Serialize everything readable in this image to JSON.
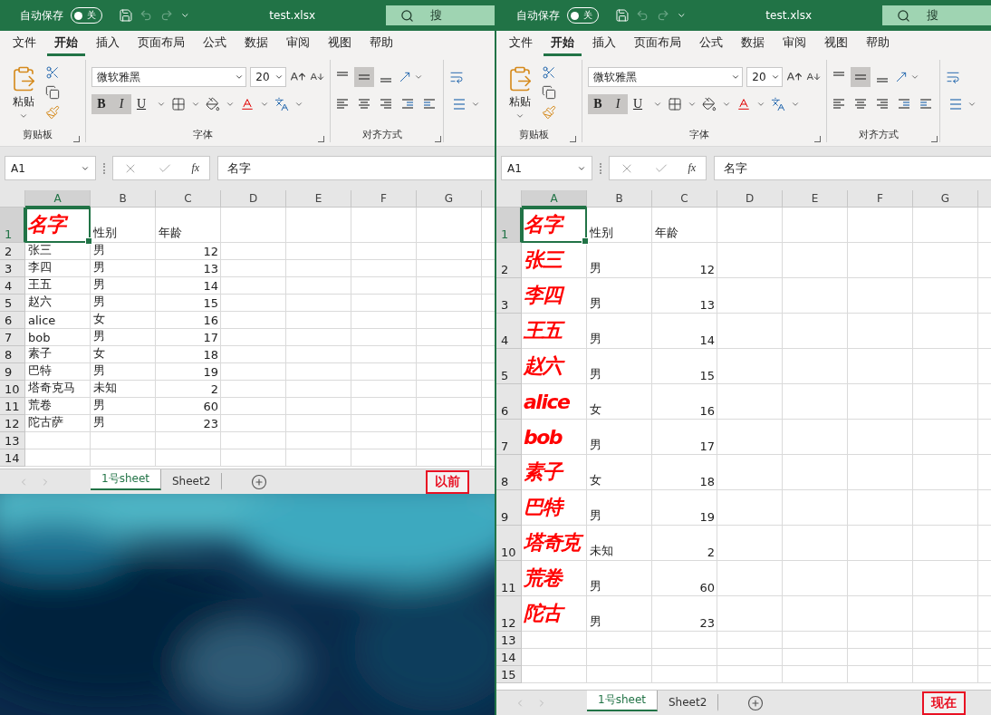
{
  "windows": [
    {
      "title_bar": {
        "autosave_label": "自动保存",
        "autosave": {
          "on": false,
          "text": "关"
        },
        "file_name": "test.xlsx",
        "search": "搜"
      },
      "ribbon_tabs": [
        {
          "label": "文件",
          "selected": false
        },
        {
          "label": "开始",
          "selected": true
        },
        {
          "label": "插入",
          "selected": false
        },
        {
          "label": "页面布局",
          "selected": false
        },
        {
          "label": "公式",
          "selected": false
        },
        {
          "label": "数据",
          "selected": false
        },
        {
          "label": "审阅",
          "selected": false
        },
        {
          "label": "视图",
          "selected": false
        },
        {
          "label": "帮助",
          "selected": false
        }
      ],
      "clipboard": {
        "paste": "粘贴",
        "group": "剪贴板"
      },
      "font": {
        "name": "微软雅黑",
        "size": "20",
        "group": "字体",
        "styles": [
          {
            "label": "B",
            "selected": true
          },
          {
            "label": "I",
            "selected": true
          },
          {
            "label": "U",
            "selected": false
          }
        ]
      },
      "alignment": {
        "group": "对齐方式",
        "vertical": [
          {
            "selected": false
          },
          {
            "selected": true
          },
          {
            "selected": false
          }
        ]
      },
      "formula_bar": {
        "name_box": "A1",
        "fx": "fx",
        "value": "名字"
      },
      "columns": [
        {
          "label": "A",
          "selected": true
        },
        {
          "label": "B",
          "selected": false
        },
        {
          "label": "C",
          "selected": false
        },
        {
          "label": "D",
          "selected": false
        },
        {
          "label": "E",
          "selected": false
        },
        {
          "label": "F",
          "selected": false
        },
        {
          "label": "G",
          "selected": false
        }
      ],
      "rows": [
        {
          "number": "1",
          "selected": true,
          "cells": [
            {
              "text": "名字",
              "kind": "emphasis",
              "selected": true
            },
            {
              "text": "性别",
              "kind": "text"
            },
            {
              "text": "年龄",
              "kind": "text"
            }
          ]
        },
        {
          "number": "2",
          "cells": [
            {
              "text": "张三",
              "kind": "text"
            },
            {
              "text": "男",
              "kind": "text"
            },
            {
              "text": "12",
              "kind": "number"
            }
          ]
        },
        {
          "number": "3",
          "cells": [
            {
              "text": "李四",
              "kind": "text"
            },
            {
              "text": "男",
              "kind": "text"
            },
            {
              "text": "13",
              "kind": "number"
            }
          ]
        },
        {
          "number": "4",
          "cells": [
            {
              "text": "王五",
              "kind": "text"
            },
            {
              "text": "男",
              "kind": "text"
            },
            {
              "text": "14",
              "kind": "number"
            }
          ]
        },
        {
          "number": "5",
          "cells": [
            {
              "text": "赵六",
              "kind": "text"
            },
            {
              "text": "男",
              "kind": "text"
            },
            {
              "text": "15",
              "kind": "number"
            }
          ]
        },
        {
          "number": "6",
          "cells": [
            {
              "text": "alice",
              "kind": "text"
            },
            {
              "text": "女",
              "kind": "text"
            },
            {
              "text": "16",
              "kind": "number"
            }
          ]
        },
        {
          "number": "7",
          "cells": [
            {
              "text": "bob",
              "kind": "text"
            },
            {
              "text": "男",
              "kind": "text"
            },
            {
              "text": "17",
              "kind": "number"
            }
          ]
        },
        {
          "number": "8",
          "cells": [
            {
              "text": "素子",
              "kind": "text"
            },
            {
              "text": "女",
              "kind": "text"
            },
            {
              "text": "18",
              "kind": "number"
            }
          ]
        },
        {
          "number": "9",
          "cells": [
            {
              "text": "巴特",
              "kind": "text"
            },
            {
              "text": "男",
              "kind": "text"
            },
            {
              "text": "19",
              "kind": "number"
            }
          ]
        },
        {
          "number": "10",
          "cells": [
            {
              "text": "塔奇克马",
              "kind": "text"
            },
            {
              "text": "未知",
              "kind": "text"
            },
            {
              "text": "2",
              "kind": "number"
            }
          ]
        },
        {
          "number": "11",
          "cells": [
            {
              "text": "荒卷",
              "kind": "text"
            },
            {
              "text": "男",
              "kind": "text"
            },
            {
              "text": "60",
              "kind": "number"
            }
          ]
        },
        {
          "number": "12",
          "cells": [
            {
              "text": "陀古萨",
              "kind": "text"
            },
            {
              "text": "男",
              "kind": "text"
            },
            {
              "text": "23",
              "kind": "number"
            }
          ]
        },
        {
          "number": "13",
          "cells": []
        },
        {
          "number": "14",
          "cells": []
        }
      ],
      "sheet_tabs": [
        {
          "label": "1号sheet",
          "selected": true
        },
        {
          "label": "Sheet2",
          "selected": false
        }
      ],
      "annotation": "以前"
    },
    {
      "title_bar": {
        "autosave_label": "自动保存",
        "autosave": {
          "on": false,
          "text": "关"
        },
        "file_name": "test.xlsx",
        "search": "搜"
      },
      "ribbon_tabs": [
        {
          "label": "文件",
          "selected": false
        },
        {
          "label": "开始",
          "selected": true
        },
        {
          "label": "插入",
          "selected": false
        },
        {
          "label": "页面布局",
          "selected": false
        },
        {
          "label": "公式",
          "selected": false
        },
        {
          "label": "数据",
          "selected": false
        },
        {
          "label": "审阅",
          "selected": false
        },
        {
          "label": "视图",
          "selected": false
        },
        {
          "label": "帮助",
          "selected": false
        }
      ],
      "clipboard": {
        "paste": "粘贴",
        "group": "剪贴板"
      },
      "font": {
        "name": "微软雅黑",
        "size": "20",
        "group": "字体",
        "styles": [
          {
            "label": "B",
            "selected": true
          },
          {
            "label": "I",
            "selected": true
          },
          {
            "label": "U",
            "selected": false
          }
        ]
      },
      "alignment": {
        "group": "对齐方式",
        "vertical": [
          {
            "selected": false
          },
          {
            "selected": true
          },
          {
            "selected": false
          }
        ]
      },
      "formula_bar": {
        "name_box": "A1",
        "fx": "fx",
        "value": "名字"
      },
      "columns": [
        {
          "label": "A",
          "selected": true
        },
        {
          "label": "B",
          "selected": false
        },
        {
          "label": "C",
          "selected": false
        },
        {
          "label": "D",
          "selected": false
        },
        {
          "label": "E",
          "selected": false
        },
        {
          "label": "F",
          "selected": false
        },
        {
          "label": "G",
          "selected": false
        }
      ],
      "rows": [
        {
          "number": "1",
          "selected": true,
          "cells": [
            {
              "text": "名字",
              "kind": "emphasis",
              "selected": true
            },
            {
              "text": "性别",
              "kind": "text"
            },
            {
              "text": "年龄",
              "kind": "text"
            }
          ]
        },
        {
          "number": "2",
          "cells": [
            {
              "text": "张三",
              "kind": "emphasis"
            },
            {
              "text": "男",
              "kind": "text"
            },
            {
              "text": "12",
              "kind": "number"
            }
          ]
        },
        {
          "number": "3",
          "cells": [
            {
              "text": "李四",
              "kind": "emphasis"
            },
            {
              "text": "男",
              "kind": "text"
            },
            {
              "text": "13",
              "kind": "number"
            }
          ]
        },
        {
          "number": "4",
          "cells": [
            {
              "text": "王五",
              "kind": "emphasis"
            },
            {
              "text": "男",
              "kind": "text"
            },
            {
              "text": "14",
              "kind": "number"
            }
          ]
        },
        {
          "number": "5",
          "cells": [
            {
              "text": "赵六",
              "kind": "emphasis"
            },
            {
              "text": "男",
              "kind": "text"
            },
            {
              "text": "15",
              "kind": "number"
            }
          ]
        },
        {
          "number": "6",
          "cells": [
            {
              "text": "alice",
              "kind": "emphasis"
            },
            {
              "text": "女",
              "kind": "text"
            },
            {
              "text": "16",
              "kind": "number"
            }
          ]
        },
        {
          "number": "7",
          "cells": [
            {
              "text": "bob",
              "kind": "emphasis"
            },
            {
              "text": "男",
              "kind": "text"
            },
            {
              "text": "17",
              "kind": "number"
            }
          ]
        },
        {
          "number": "8",
          "cells": [
            {
              "text": "素子",
              "kind": "emphasis"
            },
            {
              "text": "女",
              "kind": "text"
            },
            {
              "text": "18",
              "kind": "number"
            }
          ]
        },
        {
          "number": "9",
          "cells": [
            {
              "text": "巴特",
              "kind": "emphasis"
            },
            {
              "text": "男",
              "kind": "text"
            },
            {
              "text": "19",
              "kind": "number"
            }
          ]
        },
        {
          "number": "10",
          "cells": [
            {
              "text": "塔奇克",
              "kind": "emphasis"
            },
            {
              "text": "未知",
              "kind": "text"
            },
            {
              "text": "2",
              "kind": "number"
            }
          ]
        },
        {
          "number": "11",
          "cells": [
            {
              "text": "荒卷",
              "kind": "emphasis"
            },
            {
              "text": "男",
              "kind": "text"
            },
            {
              "text": "60",
              "kind": "number"
            }
          ]
        },
        {
          "number": "12",
          "cells": [
            {
              "text": "陀古",
              "kind": "emphasis"
            },
            {
              "text": "男",
              "kind": "text"
            },
            {
              "text": "23",
              "kind": "number"
            }
          ]
        },
        {
          "number": "13",
          "cells": []
        },
        {
          "number": "14",
          "cells": []
        },
        {
          "number": "15",
          "cells": []
        }
      ],
      "sheet_tabs": [
        {
          "label": "1号sheet",
          "selected": true
        },
        {
          "label": "Sheet2",
          "selected": false
        }
      ],
      "annotation": "现在"
    }
  ]
}
